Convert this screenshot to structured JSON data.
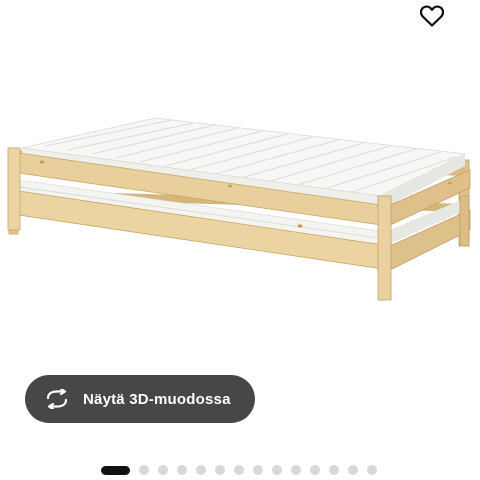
{
  "header": {
    "favorite_icon": "heart-outline-icon"
  },
  "product": {
    "image_icon": "stackable-bed-image"
  },
  "view3d": {
    "label": "Näytä 3D-muodossa",
    "icon": "rotate-3d-icon"
  },
  "carousel": {
    "total": 14,
    "active_index": 0
  },
  "colors": {
    "button_bg": "#474747",
    "active_dot": "#111111",
    "inactive_dot": "#d8d8d8"
  }
}
